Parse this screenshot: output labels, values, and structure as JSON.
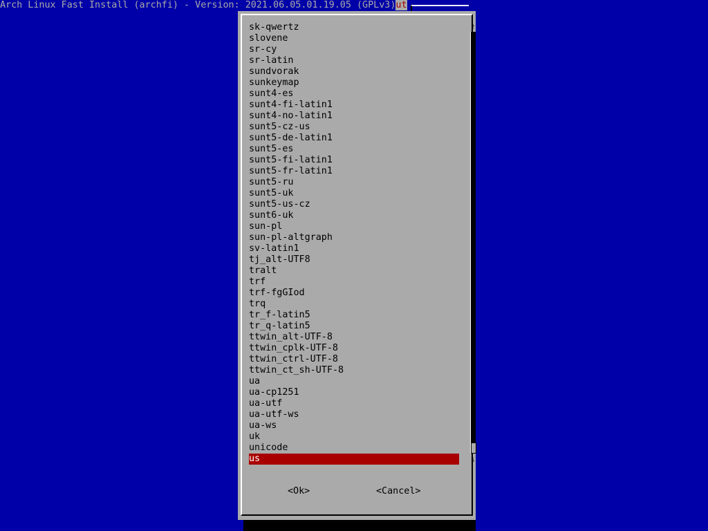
{
  "window": {
    "title": "Arch Linux Fast Install (archfi) - Version: 2021.06.05.01.19.05 (GPLv3)",
    "title_cut": "ut"
  },
  "list": {
    "items": [
      "sk-qwertz",
      "slovene",
      "sr-cy",
      "sr-latin",
      "sundvorak",
      "sunkeymap",
      "sunt4-es",
      "sunt4-fi-latin1",
      "sunt4-no-latin1",
      "sunt5-cz-us",
      "sunt5-de-latin1",
      "sunt5-es",
      "sunt5-fi-latin1",
      "sunt5-fr-latin1",
      "sunt5-ru",
      "sunt5-uk",
      "sunt5-us-cz",
      "sunt6-uk",
      "sun-pl",
      "sun-pl-altgraph",
      "sv-latin1",
      "tj_alt-UTF8",
      "tralt",
      "trf",
      "trf-fgGIod",
      "trq",
      "tr_f-latin5",
      "tr_q-latin5",
      "ttwin_alt-UTF-8",
      "ttwin_cplk-UTF-8",
      "ttwin_ctrl-UTF-8",
      "ttwin_ct_sh-UTF-8",
      "ua",
      "ua-cp1251",
      "ua-utf",
      "ua-utf-ws",
      "ua-ws",
      "uk",
      "unicode",
      "us"
    ],
    "selected": "us"
  },
  "scrollbar": {
    "up_arrow": "↑",
    "down_arrow": "↓",
    "position_fraction": 1.0
  },
  "buttons": {
    "ok_label": "<Ok>",
    "cancel_label": "<Cancel>"
  },
  "colors": {
    "background": "#0000a8",
    "dialog": "#aaaaaa",
    "highlight": "#a80000"
  }
}
